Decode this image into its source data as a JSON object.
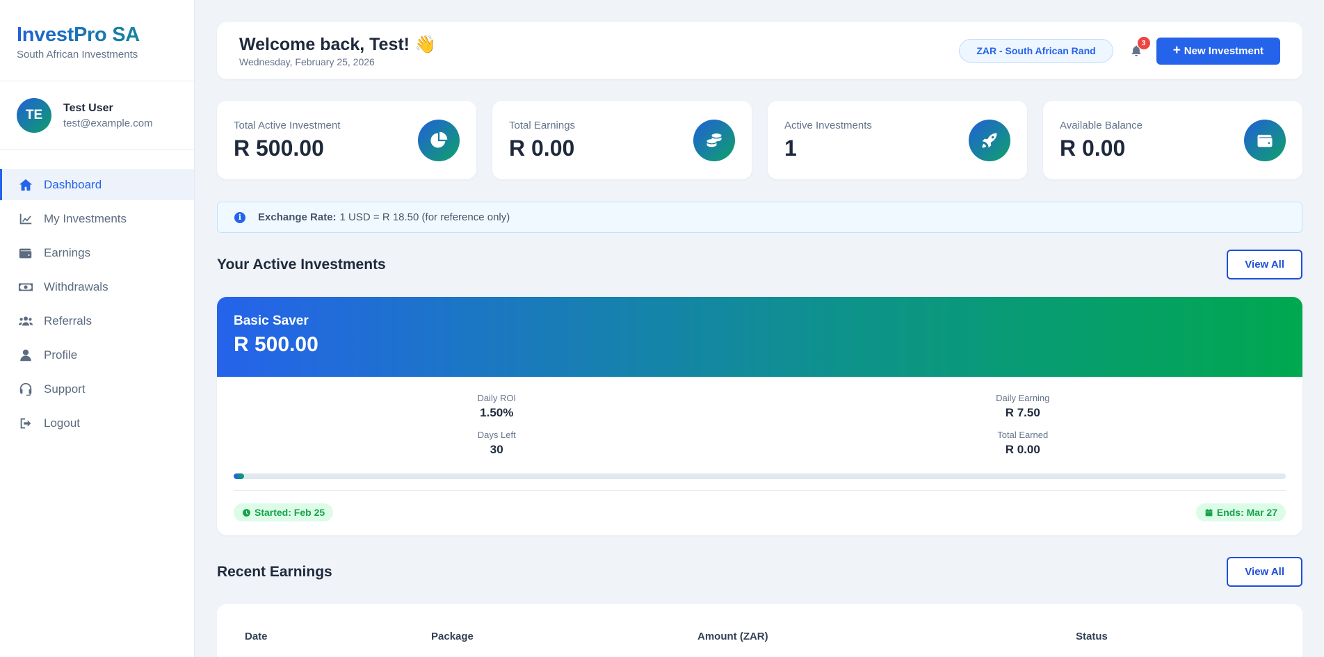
{
  "brand": {
    "name": "InvestPro SA",
    "tagline": "South African Investments"
  },
  "user": {
    "initials": "TE",
    "name": "Test User",
    "email": "test@example.com"
  },
  "nav": [
    {
      "label": "Dashboard",
      "icon": "home-icon",
      "active": true
    },
    {
      "label": "My Investments",
      "icon": "chart-line-icon"
    },
    {
      "label": "Earnings",
      "icon": "wallet-icon"
    },
    {
      "label": "Withdrawals",
      "icon": "money-bill-icon"
    },
    {
      "label": "Referrals",
      "icon": "users-icon"
    },
    {
      "label": "Profile",
      "icon": "user-icon"
    },
    {
      "label": "Support",
      "icon": "headset-icon"
    },
    {
      "label": "Logout",
      "icon": "sign-out-icon"
    }
  ],
  "header": {
    "welcome": "Welcome back, Test! 👋",
    "date": "Wednesday, February 25, 2026",
    "currency": "ZAR - South African Rand",
    "notification_count": "3",
    "new_investment_label": "New Investment",
    "new_investment_icon": "plus-icon"
  },
  "stats": [
    {
      "label": "Total Active Investment",
      "value": "R 500.00",
      "icon": "pie-chart-icon"
    },
    {
      "label": "Total Earnings",
      "value": "R 0.00",
      "icon": "coins-icon"
    },
    {
      "label": "Active Investments",
      "value": "1",
      "icon": "rocket-icon"
    },
    {
      "label": "Available Balance",
      "value": "R 0.00",
      "icon": "wallet-icon"
    }
  ],
  "exchange": {
    "label": "Exchange Rate:",
    "text": "1 USD = R 18.50 (for reference only)"
  },
  "active_investments": {
    "title": "Your Active Investments",
    "view_all": "View All",
    "items": [
      {
        "name": "Basic Saver",
        "amount": "R 500.00",
        "daily_roi_label": "Daily ROI",
        "daily_roi": "1.50%",
        "daily_earning_label": "Daily Earning",
        "daily_earning": "R 7.50",
        "days_left_label": "Days Left",
        "days_left": "30",
        "total_earned_label": "Total Earned",
        "total_earned": "R 0.00",
        "progress_percent": 1,
        "started": "Started: Feb 25",
        "ends": "Ends: Mar 27"
      }
    ]
  },
  "recent_earnings": {
    "title": "Recent Earnings",
    "view_all": "View All",
    "columns": [
      "Date",
      "Package",
      "Amount (ZAR)",
      "Status"
    ]
  },
  "colors": {
    "primary": "#2563eb",
    "accent_green": "#16a34a",
    "badge_red": "#ef4444"
  }
}
